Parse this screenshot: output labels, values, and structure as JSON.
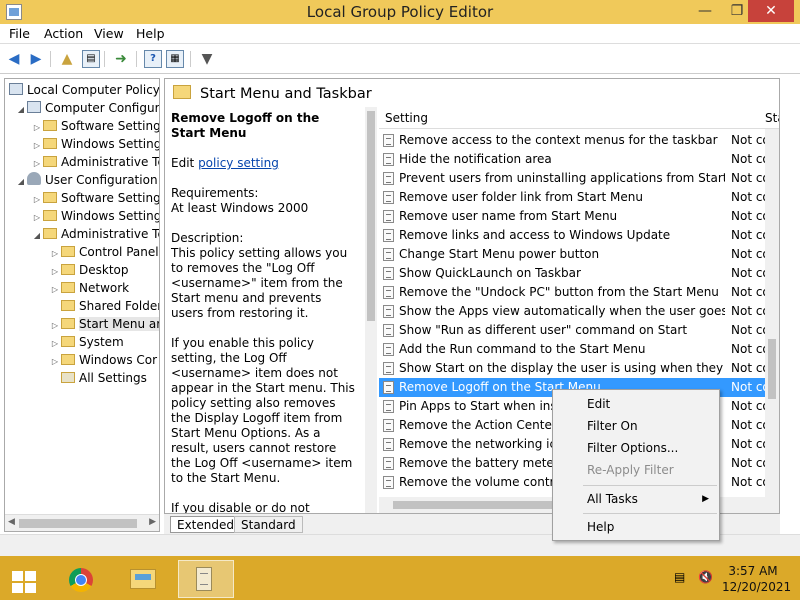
{
  "window": {
    "title": "Local Group Policy Editor",
    "minimize": "—",
    "maximize": "❐",
    "close": "✕"
  },
  "menu": [
    "File",
    "Action",
    "View",
    "Help"
  ],
  "toolbar": {
    "icons": [
      "back-arrow-icon",
      "forward-arrow-icon",
      "up-folder-icon",
      "show-hide-tree-icon",
      "export-list-icon",
      "help-icon",
      "properties-icon",
      "filter-icon"
    ]
  },
  "tree": {
    "root": "Local Computer Policy",
    "computer_config": "Computer Configura",
    "cc_software": "Software Settings",
    "cc_windows": "Windows Setting",
    "cc_admin": "Administrative Te",
    "user_config": "User Configuration",
    "uc_software": "Software Settings",
    "uc_windows": "Windows Setting",
    "uc_admin": "Administrative Te",
    "control_panel": "Control Panel",
    "desktop": "Desktop",
    "network": "Network",
    "shared_folders": "Shared Folder",
    "start_menu": "Start Menu ar",
    "system": "System",
    "windows_components": "Windows Cor",
    "all_settings": "All Settings"
  },
  "content": {
    "header_title": "Start Menu and Taskbar",
    "desc": {
      "title": "Remove Logoff on the Start Menu",
      "edit_prefix": "Edit ",
      "edit_link": "policy setting",
      "requirements_label": "Requirements:",
      "requirements_value": "At least Windows 2000",
      "description_label": "Description:",
      "description_p1": "This policy setting allows you to removes the \"Log Off <username>\" item from the Start menu and prevents users from restoring it.",
      "description_p2": "If you enable this policy setting, the Log Off <username> item does not appear in the Start menu. This policy setting also removes the Display Logoff item from Start Menu Options. As a result, users cannot restore the Log Off <username> item to the Start Menu.",
      "description_p3": "If you disable or do not configure this policy setting, users can use the Display Logoff item to add"
    },
    "columns": {
      "setting": "Setting",
      "state": "Sta"
    },
    "rows": [
      {
        "setting": "Remove access to the context menus for the taskbar",
        "state": "Not cor"
      },
      {
        "setting": "Hide the notification area",
        "state": "Not cor"
      },
      {
        "setting": "Prevent users from uninstalling applications from Start",
        "state": "Not cor"
      },
      {
        "setting": "Remove user folder link from Start Menu",
        "state": "Not cor"
      },
      {
        "setting": "Remove user name from Start Menu",
        "state": "Not cor"
      },
      {
        "setting": "Remove links and access to Windows Update",
        "state": "Not cor"
      },
      {
        "setting": "Change Start Menu power button",
        "state": "Not cor"
      },
      {
        "setting": "Show QuickLaunch on Taskbar",
        "state": "Not cor"
      },
      {
        "setting": "Remove the \"Undock PC\" button from the Start Menu",
        "state": "Not cor"
      },
      {
        "setting": "Show the Apps view automatically when the user goes to St...",
        "state": "Not cor"
      },
      {
        "setting": "Show \"Run as different user\" command on Start",
        "state": "Not cor"
      },
      {
        "setting": "Add the Run command to the Start Menu",
        "state": "Not cor"
      },
      {
        "setting": "Show Start on the display the user is using when they press t...",
        "state": "Not cor"
      },
      {
        "setting": "Remove Logoff on the Start Menu",
        "state": "Not cor"
      },
      {
        "setting": "Pin Apps to Start when instal",
        "state": "Not cor"
      },
      {
        "setting": "Remove the Action Center ic",
        "state": "Not cor"
      },
      {
        "setting": "Remove the networking icon",
        "state": "Not cor"
      },
      {
        "setting": "Remove the battery meter",
        "state": "Not cor"
      },
      {
        "setting": "Remove the volume control i",
        "state": "Not cor"
      }
    ],
    "selected_index": 13
  },
  "tabs": {
    "extended": "Extended",
    "standard": "Standard"
  },
  "context_menu": {
    "edit": "Edit",
    "filter_on": "Filter On",
    "filter_options": "Filter Options...",
    "reapply_filter": "Re-Apply Filter",
    "all_tasks": "All Tasks",
    "help": "Help"
  },
  "taskbar": {
    "time": "3:57 AM",
    "date": "12/20/2021"
  },
  "colors": {
    "titlebar": "#f0c95a",
    "taskbar": "#dba929",
    "selection": "#3399ff",
    "close_button": "#c7423b"
  }
}
